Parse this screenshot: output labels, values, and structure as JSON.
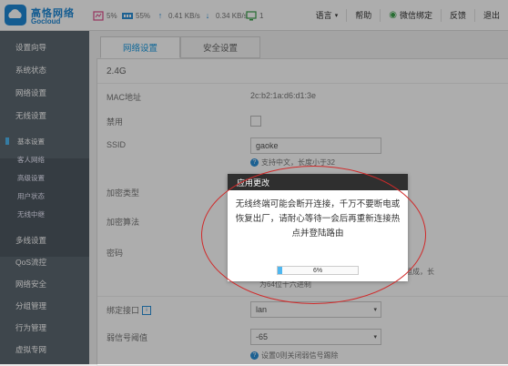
{
  "header": {
    "logo": {
      "title": "高恪网络",
      "subtitle": "Gocloud"
    },
    "stats": {
      "cpu": "5%",
      "mem": "55%",
      "up": "0.41 KB/s",
      "down": "0.34 KB/s",
      "online": "1"
    },
    "nav": {
      "language": "语言",
      "help": "帮助",
      "wechat": "微信绑定",
      "feedback": "反馈",
      "logout": "退出"
    }
  },
  "sidebar": {
    "items": [
      {
        "label": "设置向导"
      },
      {
        "label": "系统状态"
      },
      {
        "label": "网络设置"
      },
      {
        "label": "无线设置"
      },
      {
        "label": "基本设置"
      },
      {
        "label": "客人网络"
      },
      {
        "label": "高级设置"
      },
      {
        "label": "用户状态"
      },
      {
        "label": "无线中继"
      },
      {
        "label": "多线设置"
      },
      {
        "label": "QoS流控"
      },
      {
        "label": "网络安全"
      },
      {
        "label": "分组管理"
      },
      {
        "label": "行为管理"
      },
      {
        "label": "虚拟专网"
      }
    ]
  },
  "tabs": [
    "网络设置",
    "安全设置"
  ],
  "form": {
    "band": "2.4G",
    "mac_label": "MAC地址",
    "mac_value": "2c:b2:1a:d6:d1:3e",
    "disable_label": "禁用",
    "ssid_label": "SSID",
    "ssid_value": "gaoke",
    "ssid_hint": "支持中文，长度小于32",
    "enc_label": "加密类型",
    "alg_label": "加密算法",
    "pwd_label": "密码",
    "pwd_hint_a": "度8-63位，支持特殊字符组成，长",
    "pwd_hint_b": "为64位十六进制",
    "iface_label": "绑定接口",
    "iface_value": "lan",
    "signal_label": "弱信号阈值",
    "signal_value": "-65",
    "signal_hint": "设置0则关闭弱信号踢除"
  },
  "dialog": {
    "title": "应用更改",
    "message": "无线终端可能会断开连接，千万不要断电或恢复出厂，请耐心等待一会后再重新连接热点并登陆路由",
    "progress_text": "6%",
    "progress": 0.06
  },
  "colors": {
    "accent": "#1e88d6",
    "sidebar": "#5c6770",
    "highlight": "#d02a2a"
  }
}
